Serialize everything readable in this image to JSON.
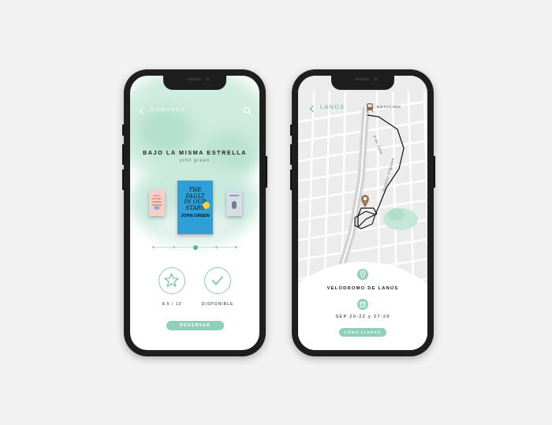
{
  "left_screen": {
    "category": "ROMANCE",
    "book_title": "BAJO LA MISMA ESTRELLA",
    "author": "john green",
    "main_cover": {
      "title_line1": "THE FAULT",
      "title_line2": "IN OUR STARS",
      "author": "JOHN GREEN"
    },
    "side_cover_left": {
      "text": "SALLY ROONEY  NORMAL PEOPLE"
    },
    "rating": "8.5 / 10",
    "availability": "DISPONIBLE",
    "reserve_label": "RESERVAR"
  },
  "right_screen": {
    "location": "LANÚS",
    "station_label": "ESTACIÓN",
    "street_1": "9 de Julio",
    "street_2": "Hipólito Yrigoyen",
    "venue": "VELODROMO DE LANÚS",
    "dates": "SEP 20-22 y 27-29",
    "directions_label": "CÓMO LLEGAR"
  },
  "colors": {
    "accent": "#8fd0b8",
    "accent_dark": "#5bb394",
    "watercolor": "#bfe6d6"
  }
}
